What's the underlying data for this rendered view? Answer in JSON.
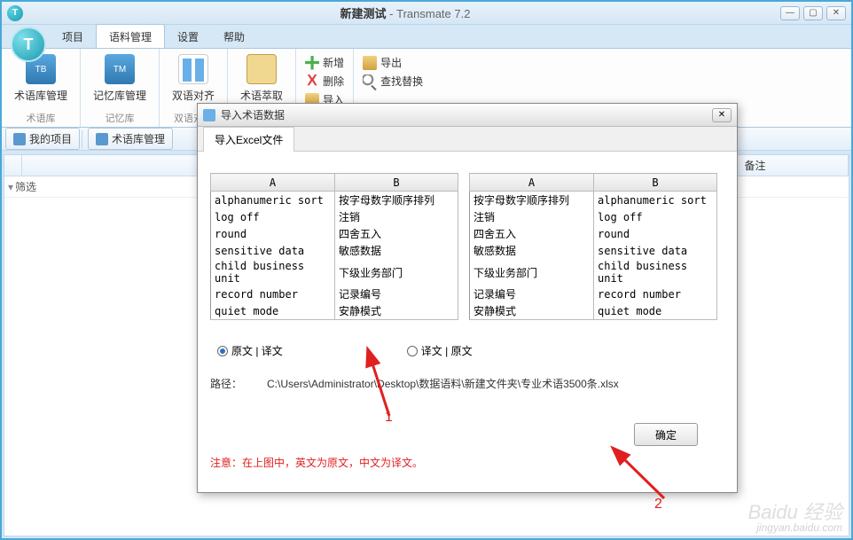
{
  "window": {
    "title_project": "新建测试",
    "app_name": " - Transmate 7.2"
  },
  "menu": {
    "items": [
      "项目",
      "语料管理",
      "设置",
      "帮助"
    ],
    "active_index": 1
  },
  "ribbon": {
    "groups": [
      {
        "label": "术语库",
        "buttons": [
          {
            "label": "术语库管理",
            "icon": "TB"
          }
        ]
      },
      {
        "label": "记忆库",
        "buttons": [
          {
            "label": "记忆库管理",
            "icon": "TM"
          }
        ]
      },
      {
        "label": "双语对齐",
        "buttons": [
          {
            "label": "双语对齐",
            "icon": "align"
          }
        ]
      },
      {
        "label": "",
        "buttons": [
          {
            "label": "术语萃取",
            "icon": "extract"
          }
        ]
      }
    ],
    "small_col1": {
      "add": "新增",
      "delete": "删除",
      "import": "导入"
    },
    "small_col2": {
      "export": "导出",
      "find_replace": "查找替换"
    }
  },
  "subbar": {
    "my_project": "我的项目",
    "term_mgmt": "术语库管理"
  },
  "grid": {
    "col_num": "",
    "col_remark": "备注",
    "filter_label": "筛选"
  },
  "dialog": {
    "title": "导入术语数据",
    "tab": "导入Excel文件",
    "table_headers": {
      "a": "A",
      "b": "B"
    },
    "left_rows": [
      [
        "alphanumeric sort",
        "按字母数字顺序排列"
      ],
      [
        "log off",
        "注销"
      ],
      [
        "round",
        "四舍五入"
      ],
      [
        "sensitive data",
        "敏感数据"
      ],
      [
        "child business unit",
        "下级业务部门"
      ],
      [
        "record number",
        "记录编号"
      ],
      [
        "quiet mode",
        "安静模式"
      ]
    ],
    "right_rows": [
      [
        "按字母数字顺序排列",
        "alphanumeric sort"
      ],
      [
        "注销",
        "log off"
      ],
      [
        "四舍五入",
        "round"
      ],
      [
        "敏感数据",
        "sensitive data"
      ],
      [
        "下级业务部门",
        "child business unit"
      ],
      [
        "记录编号",
        "record number"
      ],
      [
        "安静模式",
        "quiet mode"
      ]
    ],
    "radio_src_tgt": "原文 | 译文",
    "radio_tgt_src": "译文 | 原文",
    "path_label": "路径：",
    "path_value": "C:\\Users\\Administrator\\Desktop\\数据语料\\新建文件夹\\专业术语3500条.xlsx",
    "ok": "确定",
    "note": "注意：在上图中，英文为原文，中文为译文。"
  },
  "annotations": {
    "label1": "1",
    "label2": "2"
  },
  "watermark": {
    "brand": "Baidu 经验",
    "url": "jingyan.baidu.com"
  }
}
